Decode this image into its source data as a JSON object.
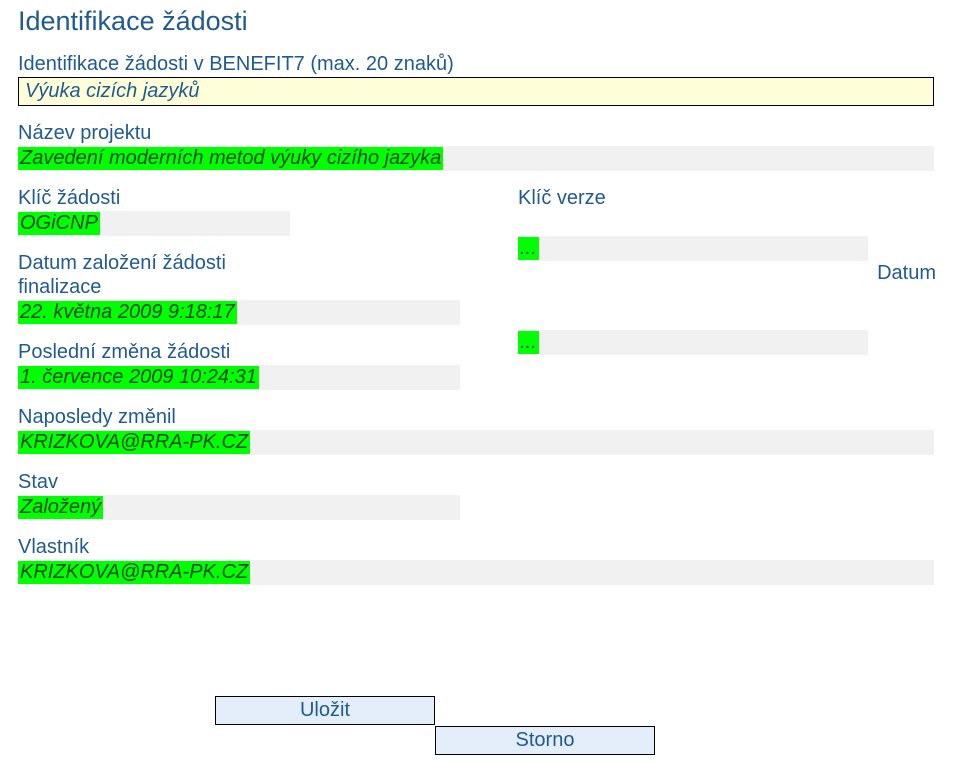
{
  "title": "Identifikace žádosti",
  "ident": {
    "label": "Identifikace žádosti v BENEFIT7 (max. 20 znaků)",
    "value": "Výuka cizích jazyků"
  },
  "project": {
    "label": "Název projektu",
    "value": "Zavedení moderních metod výuky cizího jazyka"
  },
  "key_request": {
    "label": "Klíč žádosti",
    "value": "OGiCNP"
  },
  "key_version": {
    "label": "Klíč verze",
    "value": "..."
  },
  "created": {
    "label": "Datum založení žádosti",
    "value": "22. května 2009 9:18:17"
  },
  "finalization": {
    "label_left": "finalizace",
    "label_right": "Datum",
    "value": "..."
  },
  "last_change": {
    "label": "Poslední změna žádosti",
    "value": "1. července 2009 10:24:31"
  },
  "last_changed_by": {
    "label": "Naposledy změnil",
    "value": "KRIZKOVA@RRA-PK.CZ"
  },
  "status": {
    "label": "Stav",
    "value": "Založený"
  },
  "owner": {
    "label": "Vlastník",
    "value": "KRIZKOVA@RRA-PK.CZ"
  },
  "buttons": {
    "save": "Uložit",
    "cancel": "Storno"
  }
}
